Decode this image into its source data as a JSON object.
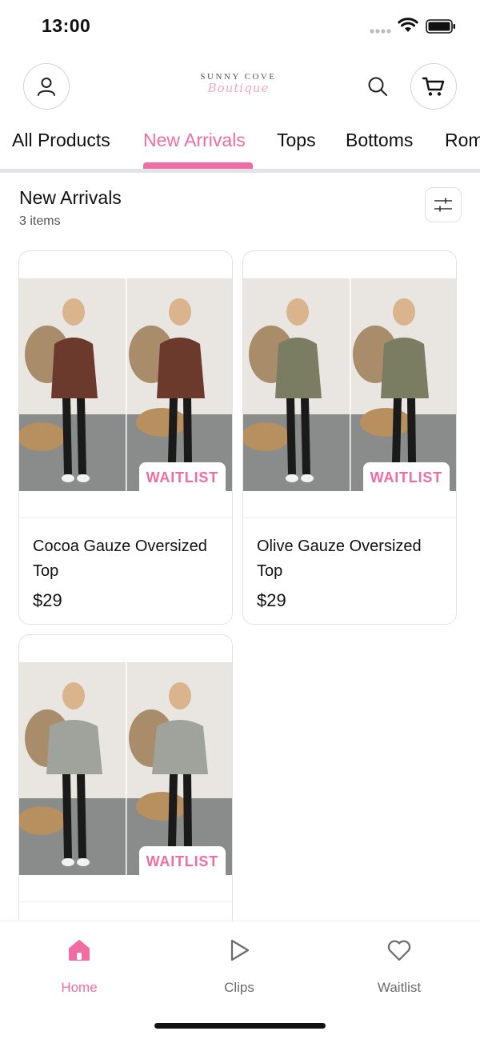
{
  "status_bar": {
    "time": "13:00"
  },
  "header": {
    "brand_top": "SUNNY COVE",
    "brand_script": "Boutique",
    "icons": [
      "account-icon",
      "search-icon",
      "cart-icon"
    ]
  },
  "tabs": [
    {
      "label": "All Products",
      "active": false
    },
    {
      "label": "New Arrivals",
      "active": true
    },
    {
      "label": "Tops",
      "active": false
    },
    {
      "label": "Bottoms",
      "active": false
    },
    {
      "label": "Rompers",
      "active": false
    }
  ],
  "section": {
    "title": "New Arrivals",
    "count": "3 items"
  },
  "products": [
    {
      "name": "Cocoa Gauze Oversized Top",
      "price": "$29",
      "badge": "WAITLIST",
      "color": "#6b3a2c"
    },
    {
      "name": "Olive Gauze Oversized Top",
      "price": "$29",
      "badge": "WAITLIST",
      "color": "#7b7d62"
    },
    {
      "name": "",
      "price": "",
      "badge": "WAITLIST",
      "color": "#9fa39b"
    }
  ],
  "bottom_nav": [
    {
      "label": "Home",
      "icon": "home-icon",
      "active": true
    },
    {
      "label": "Clips",
      "icon": "play-icon",
      "active": false
    },
    {
      "label": "Waitlist",
      "icon": "heart-icon",
      "active": false
    }
  ],
  "colors": {
    "accent": "#f06ca3",
    "divider": "#e2e4e8"
  }
}
